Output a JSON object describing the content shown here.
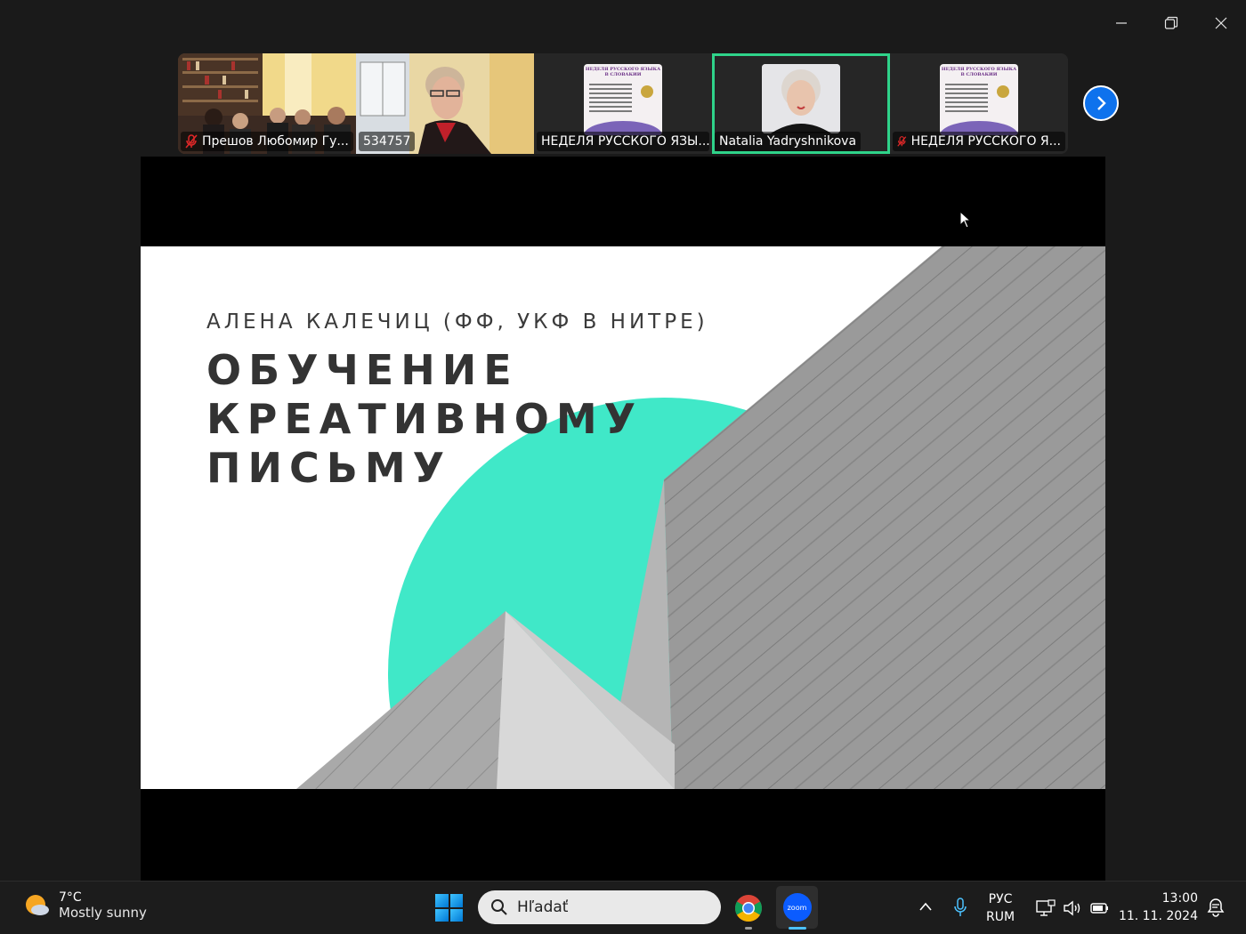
{
  "window": {
    "controls": [
      "minimize",
      "restore",
      "close"
    ]
  },
  "participants": [
    {
      "name": "Прешов Любомир Гу...",
      "muted": true,
      "kind": "video"
    },
    {
      "name": "534757",
      "muted": false,
      "kind": "video"
    },
    {
      "name": "НЕДЕЛЯ РУССКОГО ЯЗЫ...",
      "muted": false,
      "kind": "poster"
    },
    {
      "name": "Natalia Yadryshnikova",
      "muted": false,
      "kind": "face",
      "active": true
    },
    {
      "name": "НЕДЕЛЯ РУССКОГО Я...",
      "muted": true,
      "kind": "poster"
    }
  ],
  "poster": {
    "title": "НЕДЕЛЯ РУССКОГО ЯЗЫКА В СЛОВАКИИ"
  },
  "slide": {
    "author": "АЛЕНА КАЛЕЧИЦ (ФФ, УКФ В НИТРЕ)",
    "title_lines": [
      "ОБУЧЕНИЕ",
      "КРЕАТИВНОМУ",
      "ПИСЬМУ"
    ],
    "accent_color": "#40e8c8"
  },
  "taskbar": {
    "weather_temp": "7°C",
    "weather_desc": "Mostly sunny",
    "search_placeholder": "Hľadať",
    "lang_top": "РУС",
    "lang_bottom": "RUM",
    "time": "13:00",
    "date": "11. 11. 2024",
    "apps": [
      "start",
      "search",
      "chrome",
      "zoom"
    ]
  },
  "colors": {
    "active_border": "#2fd38a",
    "zoom_blue": "#0e72ed",
    "background": "#1a1a1a"
  }
}
